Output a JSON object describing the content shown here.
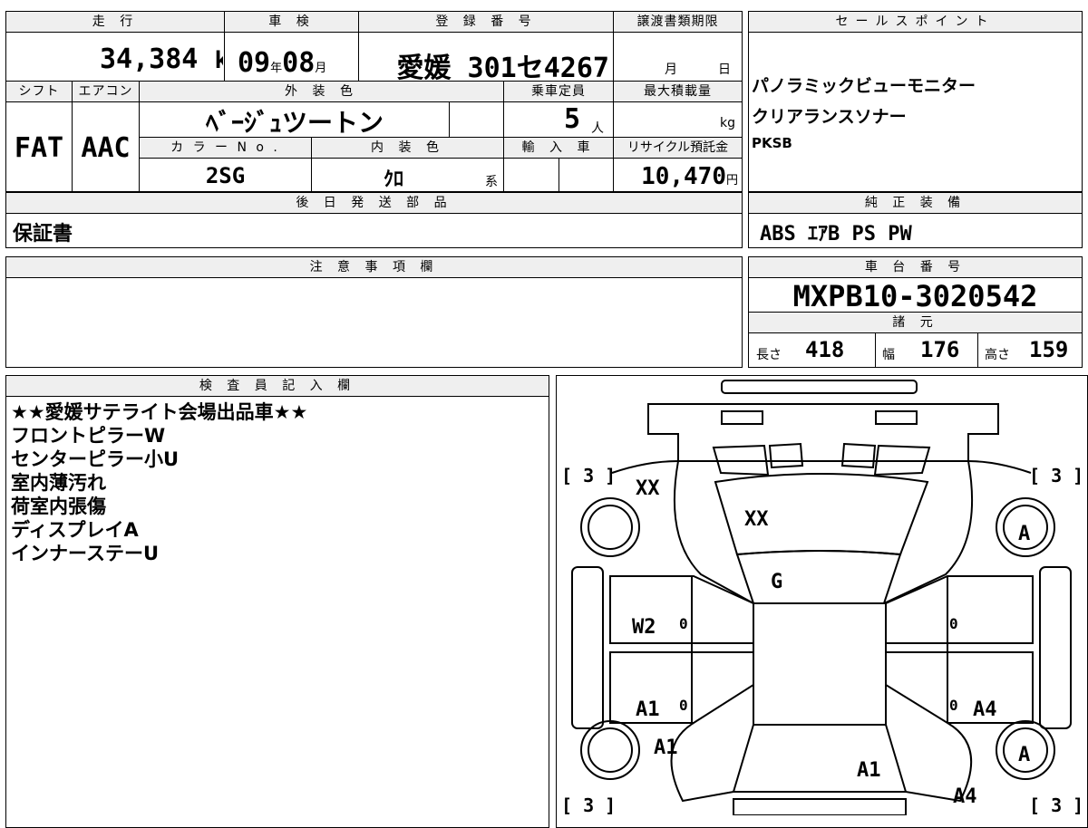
{
  "top": {
    "mileage_label": "走 行",
    "mileage_value": "34,384",
    "mileage_unit": "km",
    "inspection_label": "車 検",
    "inspection_year": "09",
    "year_unit": "年",
    "inspection_month": "08",
    "month_unit": "月",
    "registration_label": "登 録 番 号",
    "registration_value": "愛媛 301セ4267",
    "transfer_label": "譲渡書類期限",
    "transfer_month": "月",
    "transfer_day": "日",
    "shift_label": "シフト",
    "shift_value": "FAT",
    "ac_label": "エアコン",
    "ac_value": "AAC",
    "exterior_label": "外 装 色",
    "exterior_value": "ﾍﾞｰｼﾞｭツートン",
    "capacity_label": "乗車定員",
    "capacity_value": "5",
    "capacity_unit": "人",
    "maxload_label": "最大積載量",
    "maxload_unit": "kg",
    "color_no_label": "カ ラ ー N o .",
    "color_no_value": "2SG",
    "interior_label": "内 装 色",
    "interior_value": "ｸﾛ",
    "interior_unit": "系",
    "import_label": "輸 入 車",
    "recycle_label": "リサイクル預託金",
    "recycle_value": "10,470",
    "recycle_unit": "円"
  },
  "sales_point": {
    "label": "セールスポイント",
    "lines": [
      "パノラミックビューモニター",
      "クリアランスソナー",
      "PKSB"
    ]
  },
  "later_parts": {
    "label": "後 日 発 送 部 品",
    "value": "保証書"
  },
  "genuine_equipment": {
    "label": "純 正 装 備",
    "value": "ABS ｴｱB PS PW"
  },
  "caution": {
    "label": "注 意 事 項 欄"
  },
  "chassis": {
    "label": "車 台 番 号",
    "value": "MXPB10-3020542"
  },
  "specs": {
    "label": "諸 元",
    "length_label": "長さ",
    "length_value": "418",
    "width_label": "幅",
    "width_value": "176",
    "height_label": "高さ",
    "height_value": "159"
  },
  "inspector": {
    "label": "検 査 員 記 入 欄",
    "lines": [
      "★★愛媛サテライト会場出品車★★",
      "フロントピラーW",
      "センターピラー小U",
      "室内薄汚れ",
      "荷室内張傷",
      "ディスプレイA",
      "インナーステーU"
    ]
  },
  "diagram": {
    "marks": {
      "tire_fl": "[ 3 ]",
      "tire_fr": "[ 3 ]",
      "tire_rl": "[ 3 ]",
      "tire_rr": "[ 3 ]",
      "front_left_fender": "XX",
      "windshield": "XX",
      "hood": "G",
      "front_left_door": "W2",
      "rear_left_door": "A1",
      "rear_left_fender": "A1",
      "rear_hatch": "A1",
      "rear_right_door": "A4",
      "rear_right_fender": "A4",
      "front_right_wheel": "A",
      "rear_right_wheel": "A",
      "door_zero_1": "0",
      "door_zero_2": "0",
      "door_zero_3": "0",
      "door_zero_4": "0"
    }
  }
}
